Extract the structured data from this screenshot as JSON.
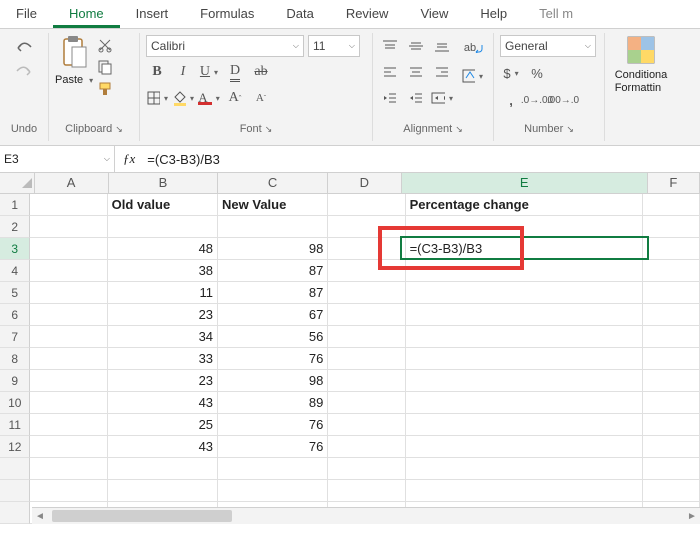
{
  "tabs": {
    "file": "File",
    "home": "Home",
    "insert": "Insert",
    "formulas": "Formulas",
    "data": "Data",
    "review": "Review",
    "view": "View",
    "help": "Help",
    "tell": "Tell m"
  },
  "ribbon": {
    "undo": "Undo",
    "clipboard": {
      "label": "Clipboard",
      "paste": "Paste"
    },
    "font": {
      "label": "Font",
      "name": "Calibri",
      "size": "11"
    },
    "alignment": {
      "label": "Alignment"
    },
    "number": {
      "label": "Number",
      "format": "General"
    },
    "styles": {
      "cond1": "Conditiona",
      "cond2": "Formattin"
    }
  },
  "formula_bar": {
    "name": "E3",
    "formula": "=(C3-B3)/B3"
  },
  "columns": [
    "A",
    "B",
    "C",
    "D",
    "E",
    "F"
  ],
  "rows": [
    "1",
    "2",
    "3",
    "4",
    "5",
    "6",
    "7",
    "8",
    "9",
    "10",
    "11",
    "12"
  ],
  "headers": {
    "B": "Old value",
    "C": "New Value",
    "E": "Percentage change"
  },
  "data": [
    {
      "B": "48",
      "C": "98"
    },
    {
      "B": "38",
      "C": "87"
    },
    {
      "B": "11",
      "C": "87"
    },
    {
      "B": "23",
      "C": "67"
    },
    {
      "B": "34",
      "C": "56"
    },
    {
      "B": "33",
      "C": "76"
    },
    {
      "B": "23",
      "C": "98"
    },
    {
      "B": "43",
      "C": "89"
    },
    {
      "B": "25",
      "C": "76"
    },
    {
      "B": "43",
      "C": "76"
    }
  ],
  "editing_cell": "=(C3-B3)/B3"
}
